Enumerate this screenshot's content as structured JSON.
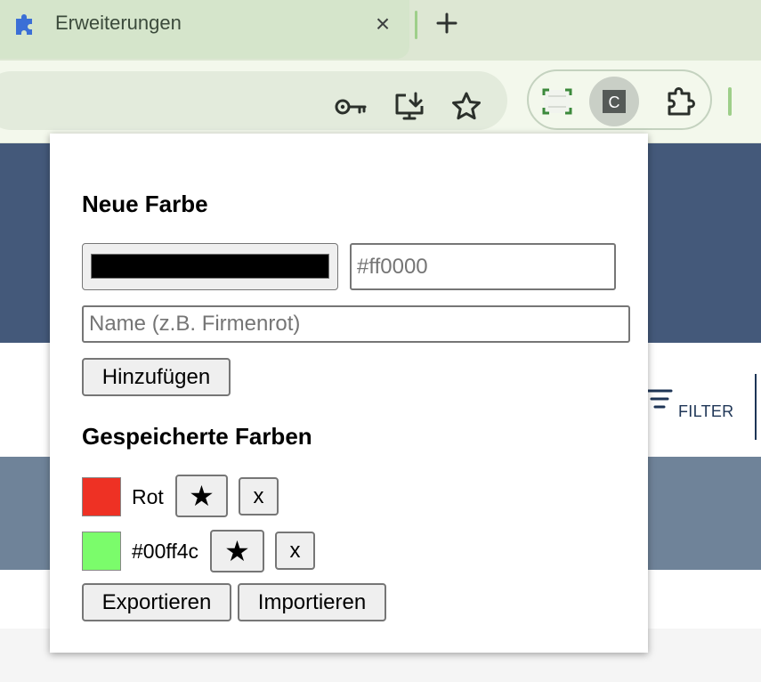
{
  "browser": {
    "tab_title": "Erweiterungen",
    "tab_close_glyph": "×",
    "tab_icon": "puzzle-piece-icon",
    "new_tab_icon": "plus-icon",
    "toolbar_icons": [
      "key-icon",
      "install-app-icon",
      "bookmark-star-icon"
    ],
    "extension_icons": [
      "screenshot-extension-icon",
      "color-extension-icon",
      "extensions-puzzle-icon"
    ],
    "active_extension_letter": "C",
    "accent_color": "#9ecf8a"
  },
  "page": {
    "filter_label": "FILTER",
    "header_color": "#44597a",
    "band_color": "#6f8399"
  },
  "popup": {
    "new_color_heading": "Neue Farbe",
    "picker_value": "#000000",
    "hex_input": {
      "value": "",
      "placeholder": "#ff0000"
    },
    "name_input": {
      "value": "",
      "placeholder": "Name (z.B. Firmenrot)"
    },
    "add_button": "Hinzufügen",
    "saved_heading": "Gespeicherte Farben",
    "saved_colors": [
      {
        "label": "Rot",
        "color": "#ee3124",
        "favorite_glyph": "★",
        "delete_label": "x"
      },
      {
        "label": "#00ff4c",
        "color": "#7bfc6b",
        "favorite_glyph": "★",
        "delete_label": "x"
      }
    ],
    "export_button": "Exportieren",
    "import_button": "Importieren"
  }
}
